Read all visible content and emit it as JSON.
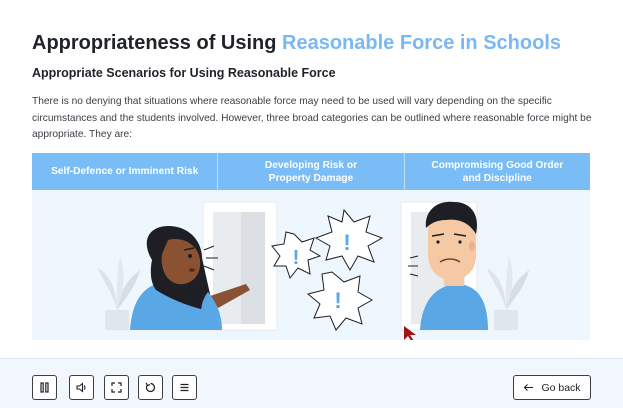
{
  "slide": {
    "title_plain": "Appropriateness of Using ",
    "title_accent": "Reasonable Force in Schools",
    "subtitle": "Appropriate Scenarios for Using Reasonable Force",
    "body": "There is no denying that situations where reasonable force may need to be used will vary depending on the specific circumstances and the students involved. However, three broad categories can be outlined where reasonable force might be appropriate. They are:",
    "tabs": [
      {
        "line1": "Self-Defence or Imminent Risk",
        "line2": ""
      },
      {
        "line1": "Developing Risk or",
        "line2": "Property Damage"
      },
      {
        "line1": "Compromising Good Order",
        "line2": "and Discipline"
      }
    ],
    "illustration": {
      "exclamation": "!"
    }
  },
  "player": {
    "controls": [
      {
        "name": "pause-button",
        "icon": "pause-icon"
      },
      {
        "name": "volume-button",
        "icon": "speaker-icon"
      },
      {
        "name": "fullscreen-button",
        "icon": "fullscreen-icon"
      },
      {
        "name": "replay-button",
        "icon": "replay-icon"
      },
      {
        "name": "menu-button",
        "icon": "menu-icon"
      }
    ],
    "back_label": "Go back"
  },
  "colors": {
    "accent": "#7ab8f5",
    "tab_bg": "#79bcf6",
    "scene_bg": "#eef6fe",
    "bar_bg": "#f1f7fd"
  }
}
